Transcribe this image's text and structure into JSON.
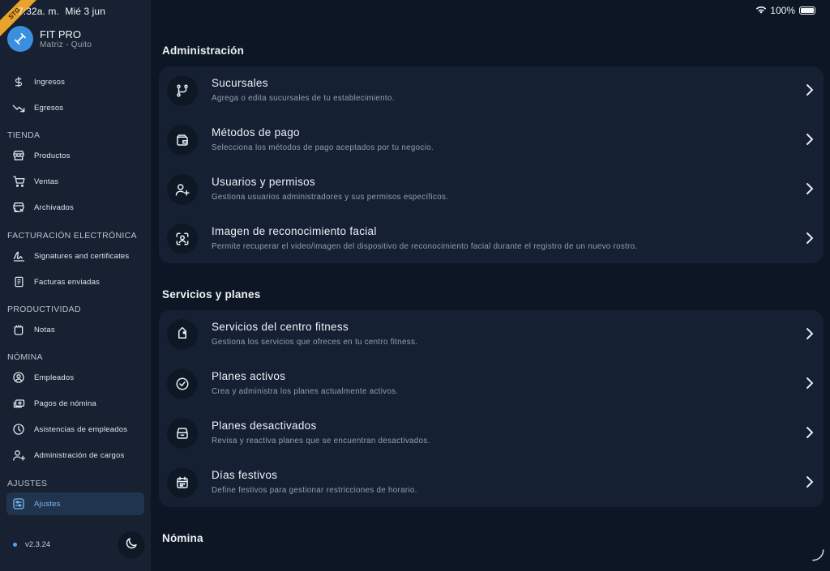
{
  "status_bar": {
    "time": "7:32a. m.",
    "date": "Mié 3 jun",
    "battery": "100%"
  },
  "badge": "STG",
  "brand": {
    "name": "FIT PRO",
    "location": "Matriz - Quito"
  },
  "sidebar": {
    "items_top": [
      {
        "label": "Ingresos",
        "icon": "dollar-icon"
      },
      {
        "label": "Egresos",
        "icon": "trend-down-icon"
      }
    ],
    "sections": [
      {
        "title": "TIENDA",
        "items": [
          {
            "label": "Productos",
            "icon": "store-icon"
          },
          {
            "label": "Ventas",
            "icon": "cart-icon"
          },
          {
            "label": "Archivados",
            "icon": "archive-store-icon"
          }
        ]
      },
      {
        "title": "FACTURACIÓN ELECTRÓNICA",
        "items": [
          {
            "label": "Signatures and certificates",
            "icon": "signature-icon"
          },
          {
            "label": "Facturas enviadas",
            "icon": "invoice-icon"
          }
        ]
      },
      {
        "title": "PRODUCTIVIDAD",
        "items": [
          {
            "label": "Notas",
            "icon": "notes-icon"
          }
        ]
      },
      {
        "title": "NÓMINA",
        "items": [
          {
            "label": "Empleados",
            "icon": "user-circle-icon"
          },
          {
            "label": "Pagos de nómina",
            "icon": "payment-icon"
          },
          {
            "label": "Asistencias de empleados",
            "icon": "clock-icon"
          },
          {
            "label": "Administración de cargos",
            "icon": "user-add-icon"
          }
        ]
      },
      {
        "title": "AJUSTES",
        "items": [
          {
            "label": "Ajustes",
            "icon": "settings-icon",
            "active": true
          }
        ]
      }
    ],
    "version": "v2.3.24"
  },
  "groups": [
    {
      "title": "Administración",
      "rows": [
        {
          "title": "Sucursales",
          "subtitle": "Agrega o edita sucursales de tu establecimiento.",
          "icon": "branch-icon"
        },
        {
          "title": "Métodos de pago",
          "subtitle": "Selecciona los métodos de pago aceptados por tu negocio.",
          "icon": "wallet-icon"
        },
        {
          "title": "Usuarios y permisos",
          "subtitle": "Gestiona usuarios administradores y sus permisos específicos.",
          "icon": "users-plus-icon"
        },
        {
          "title": "Imagen de reconocimiento facial",
          "subtitle": "Permite recuperar el video/imagen del dispositivo de reconocimiento facial durante el registro de un nuevo rostro.",
          "icon": "face-scan-icon"
        }
      ]
    },
    {
      "title": "Servicios y planes",
      "rows": [
        {
          "title": "Servicios del centro fitness",
          "subtitle": "Gestiona los servicios que ofreces en tu centro fitness.",
          "icon": "tag-icon"
        },
        {
          "title": "Planes activos",
          "subtitle": "Crea y administra los planes actualmente activos.",
          "icon": "check-circle-icon"
        },
        {
          "title": "Planes desactivados",
          "subtitle": "Revisa y reactiva planes que se encuentran desactivados.",
          "icon": "archive-box-icon"
        },
        {
          "title": "Días festivos",
          "subtitle": "Define festivos para gestionar restricciones de horario.",
          "icon": "calendar-icon"
        }
      ]
    },
    {
      "title": "Nómina",
      "rows": []
    }
  ]
}
